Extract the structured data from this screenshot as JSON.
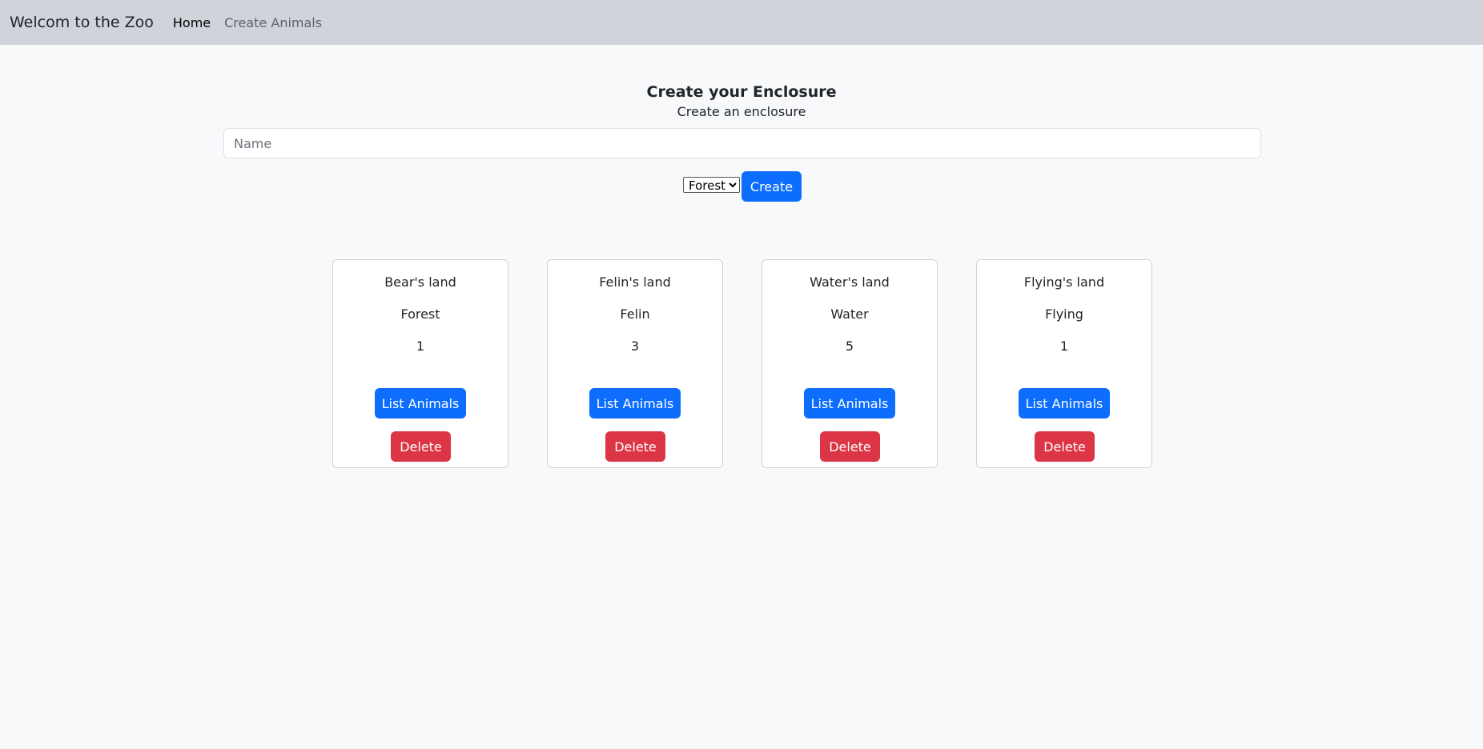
{
  "navbar": {
    "brand": "Welcom to the Zoo",
    "links": [
      {
        "label": "Home",
        "active": true
      },
      {
        "label": "Create Animals",
        "active": false
      }
    ]
  },
  "form": {
    "title": "Create your Enclosure",
    "subtitle": "Create an enclosure",
    "name_placeholder": "Name",
    "name_value": "",
    "type_selected": "Forest",
    "create_label": "Create"
  },
  "enclosures": [
    {
      "name": "Bear's land",
      "type": "Forest",
      "count": "1"
    },
    {
      "name": "Felin's land",
      "type": "Felin",
      "count": "3"
    },
    {
      "name": "Water's land",
      "type": "Water",
      "count": "5"
    },
    {
      "name": "Flying's land",
      "type": "Flying",
      "count": "1"
    }
  ],
  "card_actions": {
    "list_label": "List Animals",
    "delete_label": "Delete"
  },
  "colors": {
    "primary": "#0d6efd",
    "danger": "#dc3545",
    "navbar_bg": "#cfd3da",
    "page_bg": "#f8f9fa"
  }
}
